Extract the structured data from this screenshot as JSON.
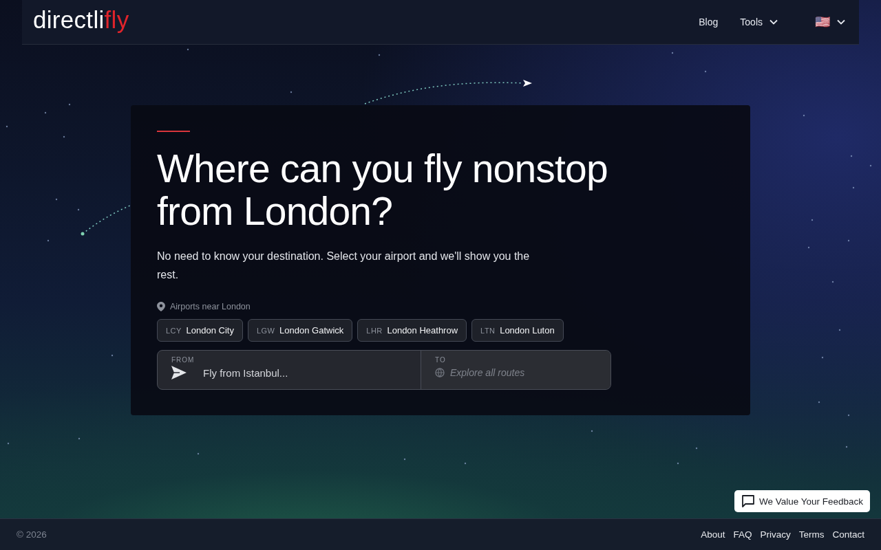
{
  "header": {
    "logo": {
      "main": "directli",
      "accent": "fly"
    },
    "nav": [
      {
        "label": "Blog",
        "kind": "link"
      },
      {
        "label": "Tools",
        "kind": "dropdown"
      },
      {
        "label": "🇺🇸",
        "kind": "dropdown"
      }
    ]
  },
  "hero": {
    "title": "Where can you fly nonstop from London?",
    "subtitle": "No need to know your destination. Select your airport and we'll show you the rest.",
    "airports_label": "Airports near London",
    "airports": [
      {
        "code": "LCY",
        "name": "London City"
      },
      {
        "code": "LGW",
        "name": "London Gatwick"
      },
      {
        "code": "LHR",
        "name": "London Heathrow"
      },
      {
        "code": "LTN",
        "name": "London Luton"
      }
    ],
    "search": {
      "from_label": "FROM",
      "from_placeholder": "Fly from Istanbul...",
      "to_label": "TO",
      "to_placeholder": "Explore all routes"
    }
  },
  "feedback_button": "We Value Your Feedback",
  "footer": {
    "copyright": "© 2026",
    "links": [
      "About",
      "FAQ",
      "Privacy",
      "Terms",
      "Contact"
    ]
  }
}
